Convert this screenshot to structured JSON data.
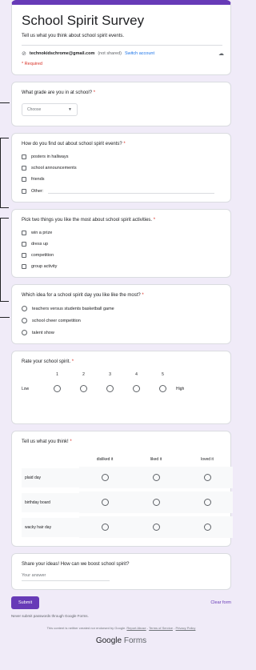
{
  "header": {
    "title": "School Spirit Survey",
    "description": "Tell us what you think about school spirit events.",
    "account_email": "technokidschrome@gmail.com",
    "not_shared": "(not shared)",
    "switch_account": "Switch account",
    "required": "* Required"
  },
  "q1": {
    "label": "What grade are you in at school?",
    "star": "*",
    "select_value": "Choose"
  },
  "q2": {
    "label": "How do you find out about school spirit events?",
    "star": "*",
    "options": [
      "posters in hallways",
      "school announcements",
      "friends",
      "Other:"
    ]
  },
  "q3": {
    "label": "Pick two things you like the most about school spirit activities.",
    "star": "*",
    "options": [
      "win a prize",
      "dress up",
      "competition",
      "group activity"
    ]
  },
  "q4": {
    "label": "Which idea for a school spirit day you like like the most?",
    "star": "*",
    "options": [
      "teachers versus students basketball game",
      "school cheer competition",
      "talent show"
    ]
  },
  "q5": {
    "label": "Rate your school spirit.",
    "star": "*",
    "numbers": [
      "1",
      "2",
      "3",
      "4",
      "5"
    ],
    "low": "Low",
    "high": "High"
  },
  "q6": {
    "label": "Tell us what you think!",
    "star": "*",
    "columns": [
      "disliked it",
      "liked it",
      "loved it"
    ],
    "rows": [
      "plaid day",
      "birthday board",
      "wacky hair day"
    ]
  },
  "q7": {
    "label": "Share your ideas! How can we boost school spirit?",
    "placeholder": "Your answer"
  },
  "footer": {
    "submit": "Submit",
    "clear": "Clear form",
    "never_submit": "Never submit passwords through Google Forms.",
    "disclaimer": "This content is neither created nor endorsed by Google.",
    "report": "Report Abuse",
    "terms": "Terms of Service",
    "privacy": "Privacy Policy",
    "brand_google": "Google",
    "brand_forms": "Forms"
  },
  "colors": {
    "accent": "#673ab7",
    "background": "#f0ebf8",
    "required": "#d93025",
    "link": "#1a73e8"
  }
}
